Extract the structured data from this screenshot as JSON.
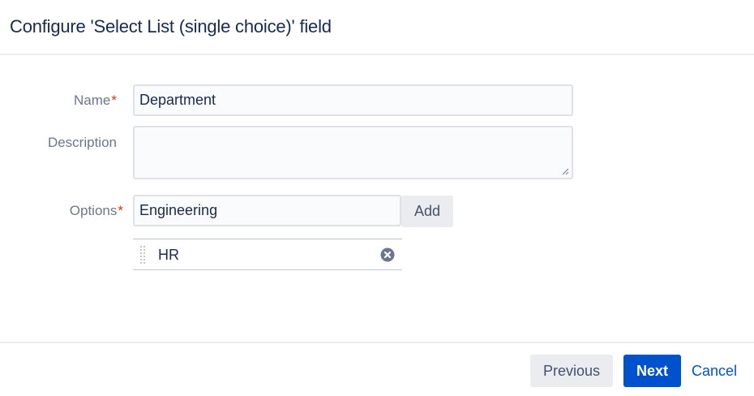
{
  "dialog": {
    "title": "Configure 'Select List (single choice)' field"
  },
  "form": {
    "name_label": "Name",
    "required_mark": "*",
    "name_value": "Department",
    "description_label": "Description",
    "description_value": "",
    "options_label": "Options",
    "options_input_value": "Engineering",
    "add_label": "Add",
    "options": [
      {
        "label": "HR"
      }
    ]
  },
  "footer": {
    "previous_label": "Previous",
    "next_label": "Next",
    "cancel_label": "Cancel"
  },
  "colors": {
    "primary": "#0052cc",
    "required": "#de350b",
    "label": "#6b778c",
    "text": "#172b4d"
  },
  "icons": {
    "grip": "drag-handle-icon",
    "remove": "remove-icon",
    "resize": "resize-handle-icon"
  }
}
